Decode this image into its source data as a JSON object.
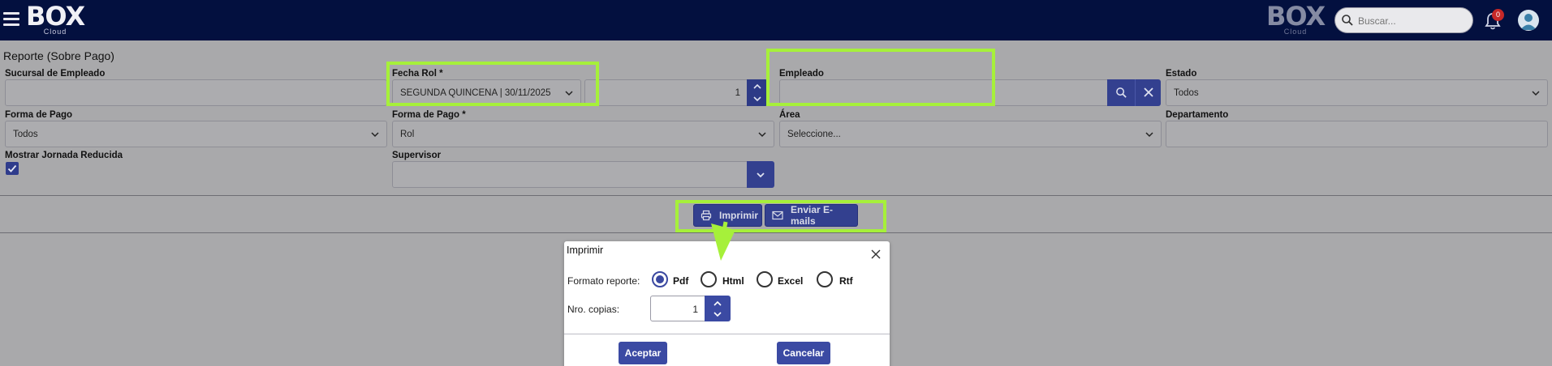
{
  "topbar": {
    "logo_word": "BOX",
    "logo_sub": "Cloud",
    "search_placeholder": "Buscar...",
    "notification_count": "0"
  },
  "page": {
    "title": "Reporte (Sobre Pago)"
  },
  "form": {
    "sucursal": {
      "label": "Sucursal de Empleado",
      "value": ""
    },
    "fecha_rol": {
      "label": "Fecha Rol",
      "required": "*",
      "value": "SEGUNDA QUINCENA | 30/11/2025",
      "number": "1"
    },
    "empleado": {
      "label": "Empleado",
      "value": ""
    },
    "estado": {
      "label": "Estado",
      "value": "Todos"
    },
    "forma_pago_1": {
      "label": "Forma de Pago",
      "value": "Todos"
    },
    "forma_pago_2": {
      "label": "Forma de Pago",
      "required": "*",
      "value": "Rol"
    },
    "area": {
      "label": "Área",
      "value": "Seleccione..."
    },
    "departamento": {
      "label": "Departamento",
      "value": ""
    },
    "jornada": {
      "label": "Mostrar Jornada Reducida",
      "checked": true
    },
    "supervisor": {
      "label": "Supervisor",
      "value": ""
    }
  },
  "actions": {
    "print_label": "Imprimir",
    "email_label": "Enviar E-mails"
  },
  "dialog": {
    "title": "Imprimir",
    "format_label": "Formato reporte:",
    "formats": [
      "Pdf",
      "Html",
      "Excel",
      "Rtf"
    ],
    "selected_format": "Pdf",
    "copies_label": "Nro. copias:",
    "copies_value": "1",
    "accept_label": "Aceptar",
    "cancel_label": "Cancelar"
  },
  "colors": {
    "topbar": "#03103f",
    "overlay_bg": "#a9a9ab",
    "primary": "#3b4aa3",
    "highlight": "#a6f03a"
  }
}
